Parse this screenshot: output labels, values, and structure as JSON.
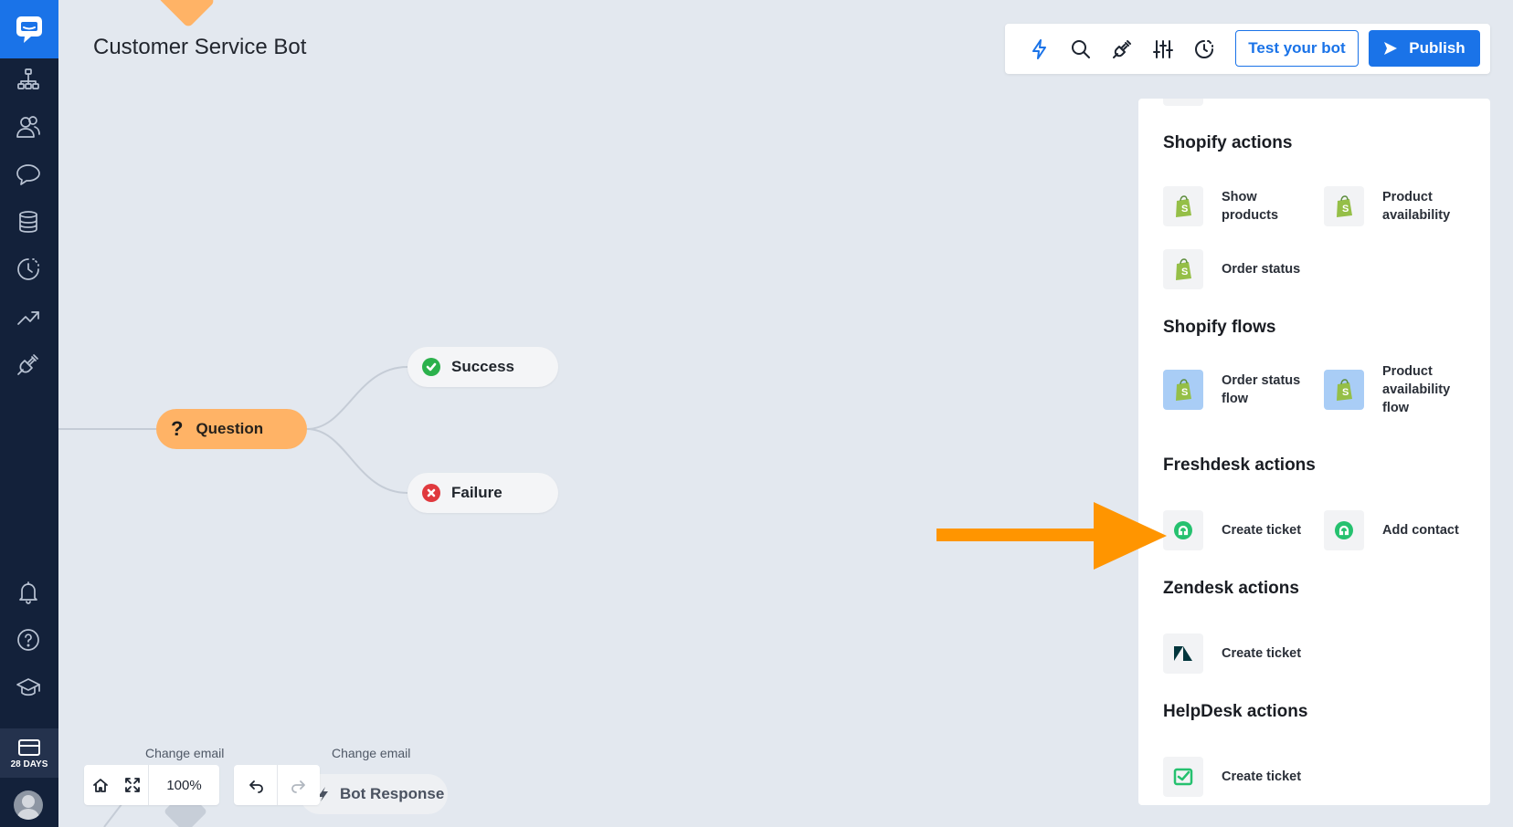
{
  "page": {
    "title": "Customer Service Bot"
  },
  "sidebar": {
    "items": [
      {
        "name": "bots"
      },
      {
        "name": "audience"
      },
      {
        "name": "conversations"
      },
      {
        "name": "data"
      },
      {
        "name": "history"
      },
      {
        "name": "reports"
      },
      {
        "name": "integrations"
      }
    ],
    "trial_label": "28 DAYS"
  },
  "toolbar": {
    "test_label": "Test your bot",
    "publish_label": "Publish"
  },
  "canvas": {
    "question_label": "Question",
    "success_label": "Success",
    "failure_label": "Failure",
    "change_email_1": "Change email",
    "change_email_2": "Change email",
    "bot_response_label": "Bot Response",
    "zoom_level": "100%"
  },
  "panel": {
    "shopify_actions": {
      "title": "Shopify actions",
      "items": [
        "Show products",
        "Product availability",
        "Order status"
      ]
    },
    "shopify_flows": {
      "title": "Shopify flows",
      "items": [
        "Order status flow",
        "Product availability flow"
      ]
    },
    "freshdesk_actions": {
      "title": "Freshdesk actions",
      "items": [
        "Create ticket",
        "Add contact"
      ]
    },
    "zendesk_actions": {
      "title": "Zendesk actions",
      "items": [
        "Create ticket"
      ]
    },
    "helpdesk_actions": {
      "title": "HelpDesk actions",
      "items": [
        "Create ticket"
      ]
    }
  },
  "colors": {
    "accent": "#1a73e8",
    "sidebar": "#13213a",
    "question_node": "#ffb366",
    "success": "#2bb14c",
    "failure": "#e0393e",
    "annotation_arrow": "#ff9500"
  }
}
